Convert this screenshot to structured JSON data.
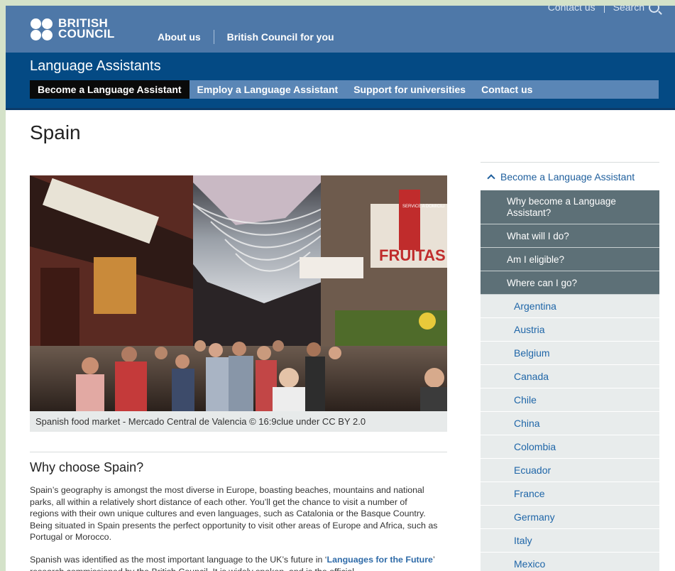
{
  "header": {
    "logo_line1": "BRITISH",
    "logo_line2": "COUNCIL",
    "util_contact": "Contact us",
    "util_search": "Search",
    "nav": [
      "About us",
      "British Council for you"
    ],
    "brand_color": "#4e78a8"
  },
  "subheader": {
    "title": "Language Assistants",
    "nav": [
      "Become a Language Assistant",
      "Employ a Language Assistant",
      "Support for universities",
      "Contact us"
    ],
    "color": "#044a84"
  },
  "page": {
    "title": "Spain",
    "caption": "Spanish food market - Mercado Central de Valencia © 16:9clue under CC BY 2.0",
    "hero_signs": [
      "FRUITAS",
      "SERVICE A DOMICILI"
    ],
    "section_title": "Why choose Spain?",
    "para1": "Spain’s geography is amongst the most diverse in Europe, boasting beaches, mountains and national parks, all within a relatively short distance of each other. You’ll get the chance to visit a number of regions with their own unique cultures and even languages, such as Catalonia or the Basque Country. Being situated in Spain presents the perfect opportunity to visit other areas of Europe and Africa, such as Portugal or Morocco.",
    "para2_before": "Spanish was identified as the most important language to the UK’s future in ‘",
    "para2_link": "Languages for the Future",
    "para2_after": "’ research commissioned by the British Council. It is widely spoken, and is the official"
  },
  "sidebar": {
    "heading": "Become a Language Assistant",
    "items": [
      "Why become a Language Assistant?",
      "What will I do?",
      "Am I eligible?",
      "Where can I go?"
    ],
    "countries": [
      "Argentina",
      "Austria",
      "Belgium",
      "Canada",
      "Chile",
      "China",
      "Colombia",
      "Ecuador",
      "France",
      "Germany",
      "Italy",
      "Mexico"
    ]
  },
  "icons": {
    "search": "search-icon",
    "expand": "chevron-up-icon"
  }
}
